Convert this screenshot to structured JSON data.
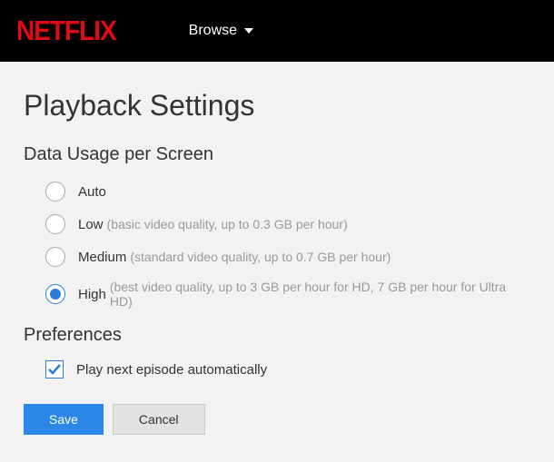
{
  "header": {
    "logo_text": "NETFLIX",
    "browse_label": "Browse"
  },
  "title": "Playback Settings",
  "data_usage": {
    "heading": "Data Usage per Screen",
    "options": [
      {
        "label": "Auto",
        "desc": "",
        "selected": false
      },
      {
        "label": "Low",
        "desc": "(basic video quality, up to 0.3 GB per hour)",
        "selected": false
      },
      {
        "label": "Medium",
        "desc": "(standard video quality, up to 0.7 GB per hour)",
        "selected": false
      },
      {
        "label": "High",
        "desc": "(best video quality, up to 3 GB per hour for HD, 7 GB per hour for Ultra HD)",
        "selected": true
      }
    ]
  },
  "preferences": {
    "heading": "Preferences",
    "autoplay_label": "Play next episode automatically",
    "autoplay_checked": true
  },
  "buttons": {
    "save": "Save",
    "cancel": "Cancel"
  }
}
